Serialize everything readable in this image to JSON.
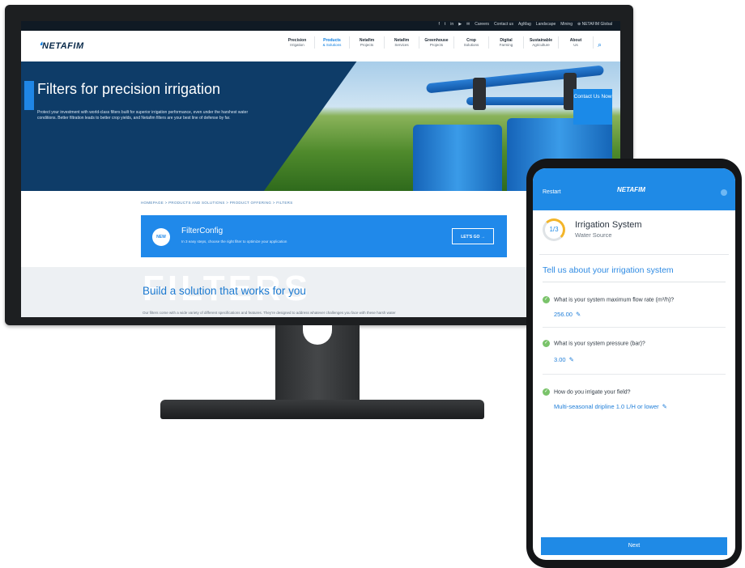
{
  "website": {
    "top_links": [
      "f",
      "t",
      "in",
      "▶",
      "✉",
      "Careers",
      "Contact us",
      "AgMag",
      "Landscape",
      "Mining",
      "⊕ NETAFIM Global"
    ],
    "logo": "NETAFIM",
    "nav": [
      {
        "line1": "Precision",
        "line2": "Irrigation"
      },
      {
        "line1": "Products",
        "line2": "& Solutions"
      },
      {
        "line1": "Netafim",
        "line2": "Projects"
      },
      {
        "line1": "Netafim",
        "line2": "Services"
      },
      {
        "line1": "Greenhouse",
        "line2": "Projects"
      },
      {
        "line1": "Crop",
        "line2": "Solutions"
      },
      {
        "line1": "Digital",
        "line2": "Farming"
      },
      {
        "line1": "Sustainable",
        "line2": "Agriculture"
      },
      {
        "line1": "About",
        "line2": "Us"
      }
    ],
    "hero": {
      "title": "Filters for precision irrigation",
      "text": "Protect your investment with world-class filters built for superior irrigation performance, even under the harshest water conditions. Better filtration leads to better crop yields, and Netafim filters are your best line of defense by far.",
      "contact": "Contact Us Now"
    },
    "breadcrumb": "HOMEPAGE > PRODUCTS AND SOLUTIONS > PRODUCT OFFERING > FILTERS",
    "filterconfig": {
      "badge": "NEW",
      "title": "FilterConfig",
      "subtitle": "In 3 easy steps, choose the right filter to optimize your application",
      "button": "LET'S GO →"
    },
    "solution": {
      "watermark": "FILTERS",
      "title": "Build a solution that works for you",
      "text": "Our filters come with a wide variety of different specifications and features. They're designed to address whatever challenges you face with these harsh water"
    }
  },
  "phone": {
    "restart": "Restart",
    "logo": "NETAFIM",
    "step": {
      "counter": "1/3",
      "title": "Irrigation System",
      "subtitle": "Water Source"
    },
    "heading": "Tell us about your irrigation system",
    "questions": [
      {
        "q": "What is your system maximum flow rate (m³/h)?",
        "a": "256.00"
      },
      {
        "q": "What is your system pressure (bar)?",
        "a": "3.00"
      },
      {
        "q": "How do you irrigate your field?",
        "a": "Multi-seasonal dripline 1.0 L/H or lower"
      }
    ],
    "next": "Next"
  },
  "colors": {
    "brand_blue": "#1f8ae6",
    "navy": "#0e3c68",
    "check_green": "#7ac36a",
    "progress_yellow": "#f3b52a"
  }
}
